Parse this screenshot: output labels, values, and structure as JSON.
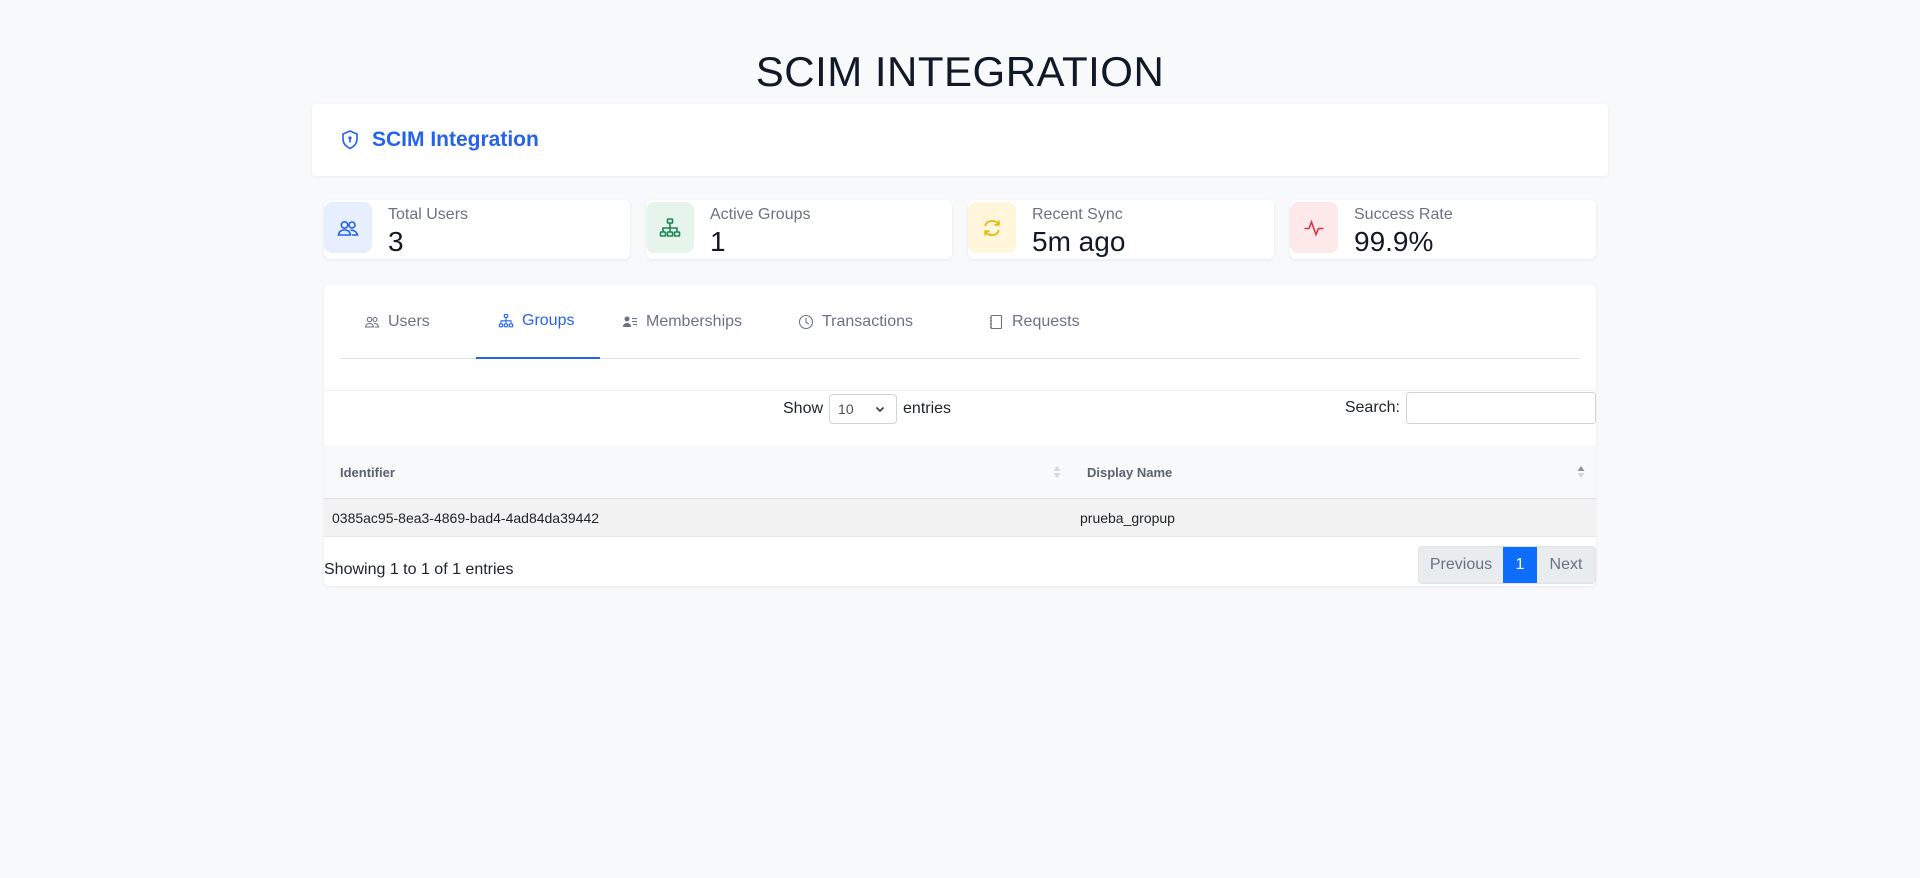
{
  "page": {
    "title": "SCIM INTEGRATION"
  },
  "header": {
    "title": "SCIM Integration",
    "icon": "shield-icon"
  },
  "stats": [
    {
      "label": "Total Users",
      "value": "3",
      "icon": "users-icon",
      "bg": "#e7efff",
      "fg": "#2563eb"
    },
    {
      "label": "Active Groups",
      "value": "1",
      "icon": "sitemap-icon",
      "bg": "#e6f4ec",
      "fg": "#198754"
    },
    {
      "label": "Recent Sync",
      "value": "5m ago",
      "icon": "sync-icon",
      "bg": "#fff6dc",
      "fg": "#f0b400"
    },
    {
      "label": "Success Rate",
      "value": "99.9%",
      "icon": "activity-icon",
      "bg": "#fde8ea",
      "fg": "#dc3545"
    }
  ],
  "tabs": [
    {
      "label": "Users",
      "icon": "users-icon"
    },
    {
      "label": "Groups",
      "icon": "sitemap-icon",
      "active": true
    },
    {
      "label": "Memberships",
      "icon": "person-lines-icon"
    },
    {
      "label": "Transactions",
      "icon": "clock-icon"
    },
    {
      "label": "Requests",
      "icon": "journal-icon"
    }
  ],
  "table_controls": {
    "show_label": "Show",
    "page_size": "10",
    "entries_label": "entries",
    "search_label": "Search:",
    "search_value": ""
  },
  "table": {
    "columns": [
      "Identifier",
      "Display Name"
    ],
    "rows": [
      [
        "0385ac95-8ea3-4869-bad4-4ad84da39442",
        "prueba_gropup"
      ]
    ]
  },
  "footer": {
    "info": "Showing 1 to 1 of 1 entries",
    "prev_label": "Previous",
    "current_page": "1",
    "next_label": "Next"
  },
  "colors": {
    "accent": "#2563eb",
    "page_active": "#0d6efd"
  }
}
